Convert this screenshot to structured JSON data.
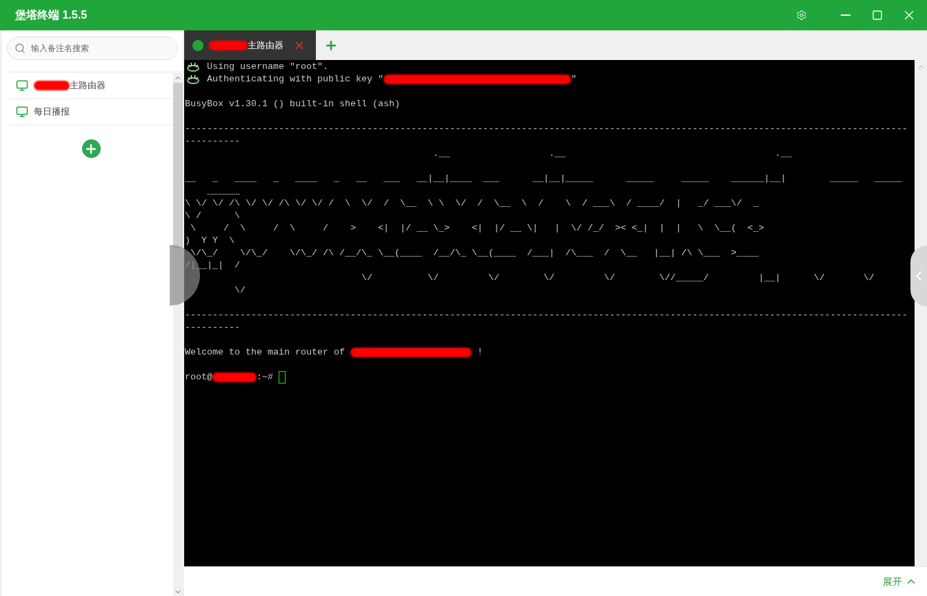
{
  "window": {
    "title": "堡塔终端 1.5.5"
  },
  "sidebar": {
    "search": {
      "placeholder": "输入备注名搜索"
    },
    "items": [
      {
        "label": "主路由器",
        "redacted_prefix": true
      },
      {
        "label": "每日播报",
        "redacted_prefix": false
      }
    ]
  },
  "tabs": [
    {
      "label": "主路由器",
      "redacted_prefix": true,
      "selected": true,
      "connected": true
    }
  ],
  "terminal": {
    "lines": [
      {
        "kind": "info",
        "segments": [
          {
            "kind": "text",
            "text": "Using username \"root\"."
          }
        ]
      },
      {
        "kind": "info",
        "segments": [
          {
            "kind": "text",
            "text": "Authenticating with public key \""
          },
          {
            "kind": "redaction_long"
          },
          {
            "kind": "text",
            "text": "\""
          }
        ]
      },
      {
        "kind": "blank"
      },
      {
        "kind": "plain",
        "segments": [
          {
            "kind": "text",
            "text": "BusyBox v1.30.1 () built-in shell (ash)"
          }
        ]
      },
      {
        "kind": "blank"
      },
      {
        "kind": "plain",
        "segments": [
          {
            "kind": "text",
            "text": "-----------------------------------------------------------------------------------------------------------------------------------"
          }
        ]
      },
      {
        "kind": "plain",
        "segments": [
          {
            "kind": "text",
            "text": "----------"
          }
        ]
      },
      {
        "kind": "plain",
        "segments": [
          {
            "kind": "text",
            "text": "                                             .__                  .__                                      .__"
          }
        ]
      },
      {
        "kind": "blank"
      },
      {
        "kind": "plain",
        "segments": [
          {
            "kind": "text",
            "text": "__   _   ____   _   ____   _   __   ___   __|__|____  ___      __|__|_____      _____     _____    ______|__|        _____   _____"
          }
        ]
      },
      {
        "kind": "plain",
        "segments": [
          {
            "kind": "text",
            "text": "    ______"
          }
        ]
      },
      {
        "kind": "plain",
        "segments": [
          {
            "kind": "text",
            "text": "\\ \\/ \\/ /\\ \\/ \\/ /\\ \\/ \\/ /  \\  \\/  /  \\__  \\ \\  \\/  /  \\__  \\  /    \\  / ___\\  / ____/  |   _/ ___\\/  _"
          }
        ]
      },
      {
        "kind": "plain",
        "segments": [
          {
            "kind": "text",
            "text": "\\ /      \\"
          }
        ]
      },
      {
        "kind": "plain",
        "segments": [
          {
            "kind": "text",
            "text": " \\     /  \\     /  \\     /    >    <|  |/ __ \\_>    <|  |/ __ \\|   |  \\/ /_/  >< <_|  |  |   \\  \\__(  <_>"
          }
        ]
      },
      {
        "kind": "plain",
        "segments": [
          {
            "kind": "text",
            "text": ")  Y Y  \\"
          }
        ]
      },
      {
        "kind": "plain",
        "segments": [
          {
            "kind": "text",
            "text": " \\/\\_/    \\/\\_/    \\/\\_/ /\\ /__/\\_ \\__(____  /__/\\_ \\__(____  /___|  /\\___  /  \\__   |__| /\\ \\___  >____"
          }
        ]
      },
      {
        "kind": "plain",
        "segments": [
          {
            "kind": "text",
            "text": "/|__|_|  /"
          }
        ]
      },
      {
        "kind": "plain",
        "segments": [
          {
            "kind": "text",
            "text": "                                \\/          \\/         \\/        \\/         \\/        \\//_____/         |__|      \\/       \\/"
          }
        ]
      },
      {
        "kind": "plain",
        "segments": [
          {
            "kind": "text",
            "text": "         \\/"
          }
        ]
      },
      {
        "kind": "blank"
      },
      {
        "kind": "plain",
        "segments": [
          {
            "kind": "text",
            "text": "-----------------------------------------------------------------------------------------------------------------------------------"
          }
        ]
      },
      {
        "kind": "plain",
        "segments": [
          {
            "kind": "text",
            "text": "----------"
          }
        ]
      },
      {
        "kind": "blank"
      },
      {
        "kind": "plain",
        "segments": [
          {
            "kind": "text",
            "text": "Welcome to the main router of "
          },
          {
            "kind": "redaction_medium"
          },
          {
            "kind": "text",
            "text": " !"
          }
        ]
      },
      {
        "kind": "blank"
      },
      {
        "kind": "plain",
        "segments": [
          {
            "kind": "text",
            "text": "root@"
          },
          {
            "kind": "redaction_short"
          },
          {
            "kind": "text",
            "text": ":~# "
          },
          {
            "kind": "cursor"
          }
        ]
      }
    ]
  },
  "footer": {
    "expand_label": "展开"
  }
}
